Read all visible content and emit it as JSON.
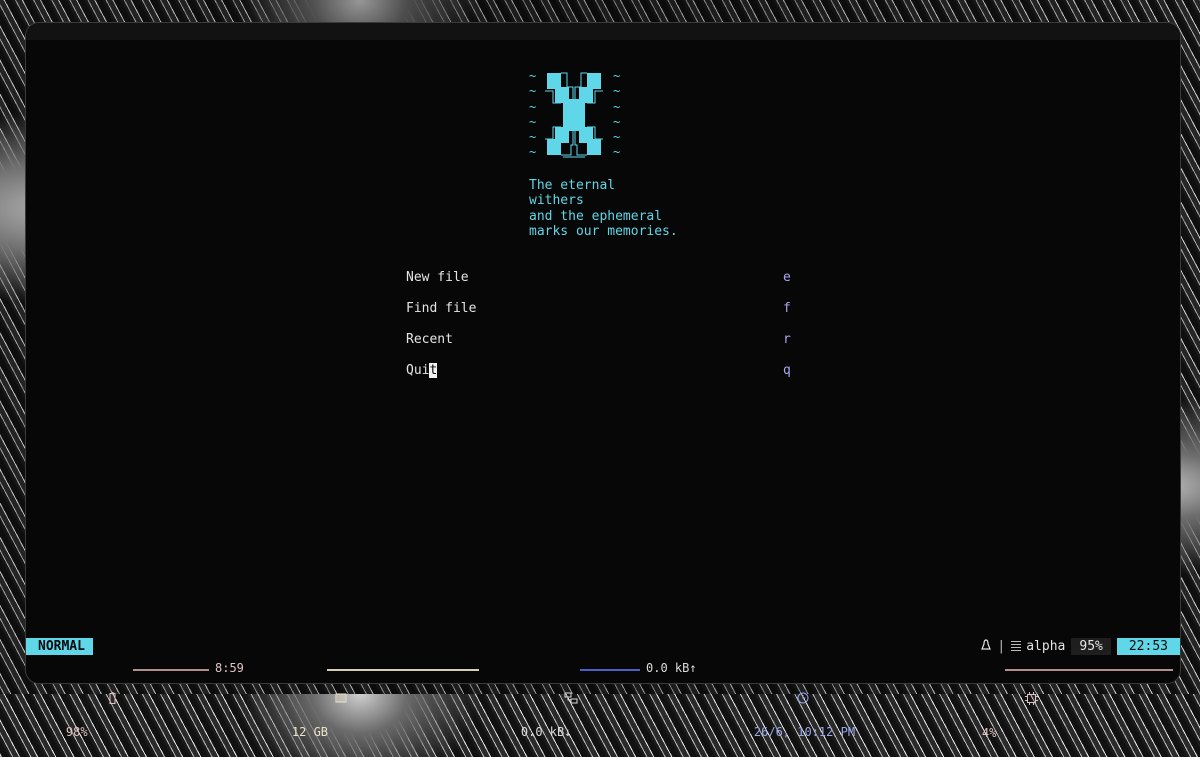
{
  "logo": {
    "name": "x-logo-icon",
    "tildes_left": [
      "~",
      "~",
      "~",
      "~",
      "~",
      "~"
    ],
    "tildes_right": [
      "~",
      "~",
      "~",
      "~",
      "~",
      "~"
    ]
  },
  "quote": {
    "lines": [
      "The eternal",
      "withers",
      "and the ephemeral",
      "marks our memories."
    ]
  },
  "menu": {
    "items": [
      {
        "label": "New file",
        "key": "e"
      },
      {
        "label": "Find file",
        "key": "f"
      },
      {
        "label": "Recent",
        "key": "r"
      },
      {
        "label_before_cursor": "Qui",
        "cursor_char": "t",
        "key": "q"
      }
    ]
  },
  "statusline": {
    "mode": "NORMAL",
    "os_icon": "linux-icon",
    "separator": "|",
    "filename": "alpha",
    "percent": "95%",
    "time": "22:53"
  },
  "sysbar": {
    "battery": "98%",
    "battery_time": "8:59",
    "memory": "12 GB",
    "net_down": "0.0 kB↓",
    "net_up": "0.0 kB↑",
    "datetime": "26/6, 10:12 PM",
    "cpu": "4%"
  },
  "colors": {
    "accent": "#5fd7e8",
    "key_color": "#a9a6f2",
    "text": "#e4e4e4",
    "background": "#070707"
  }
}
